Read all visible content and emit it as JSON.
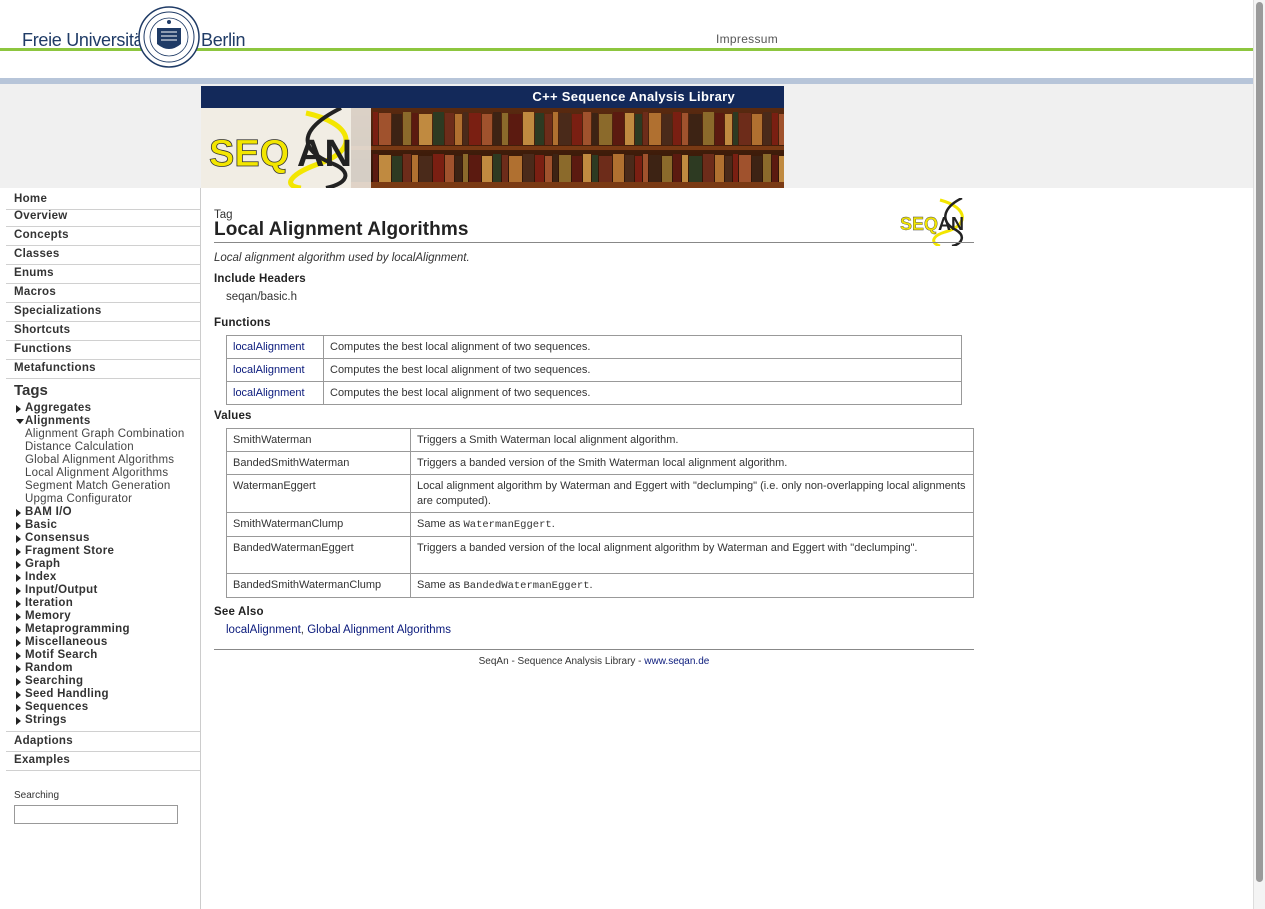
{
  "header": {
    "university_left": "Freie Universität",
    "university_right": "Berlin",
    "impressum": "Impressum"
  },
  "banner": {
    "subtitle": "C++ Sequence Analysis Library"
  },
  "nav": {
    "main": [
      "Home",
      "Overview",
      "Concepts",
      "Classes",
      "Enums",
      "Macros",
      "Specializations",
      "Shortcuts",
      "Functions",
      "Metafunctions"
    ],
    "tags_heading": "Tags",
    "tags_before": [
      "Aggregates"
    ],
    "expanded_tag": "Alignments",
    "expanded_children": [
      "Alignment Graph Combination",
      "Distance Calculation",
      "Global Alignment Algorithms",
      "Local Alignment Algorithms",
      "Segment Match Generation",
      "Upgma Configurator"
    ],
    "tags_after": [
      "BAM I/O",
      "Basic",
      "Consensus",
      "Fragment Store",
      "Graph",
      "Index",
      "Input/Output",
      "Iteration",
      "Memory",
      "Metaprogramming",
      "Miscellaneous",
      "Motif Search",
      "Random",
      "Searching",
      "Seed Handling",
      "Sequences",
      "Strings"
    ],
    "bottom": [
      "Adaptions",
      "Examples"
    ],
    "search_label": "Searching",
    "search_value": ""
  },
  "main": {
    "kind": "Tag",
    "title": "Local Alignment Algorithms",
    "summary": "Local alignment algorithm used by localAlignment.",
    "include_heading": "Include Headers",
    "include_file": "seqan/basic.h",
    "functions_heading": "Functions",
    "functions": [
      {
        "name": "localAlignment",
        "desc": "Computes the best local alignment of two sequences."
      },
      {
        "name": "localAlignment",
        "desc": "Computes the best local alignment of two sequences."
      },
      {
        "name": "localAlignment",
        "desc": "Computes the best local alignment of two sequences."
      }
    ],
    "values_heading": "Values",
    "values": [
      {
        "name": "SmithWaterman",
        "desc": "Triggers a Smith Waterman local alignment algorithm.",
        "code": ""
      },
      {
        "name": "BandedSmithWaterman",
        "desc": "Triggers a banded version of the Smith Waterman local alignment algorithm.",
        "code": ""
      },
      {
        "name": "WatermanEggert",
        "desc": "Local alignment algorithm by Waterman and Eggert with \"declumping\" (i.e. only non-overlapping local alignments are computed).",
        "code": ""
      },
      {
        "name": "SmithWatermanClump",
        "desc": "Same as ",
        "code": "WatermanEggert"
      },
      {
        "name": "BandedWatermanEggert",
        "desc": "Triggers a banded version of the local alignment algorithm by Waterman and Eggert with \"declumping\".",
        "code": ""
      },
      {
        "name": "BandedSmithWatermanClump",
        "desc": "Same as ",
        "code": "BandedWatermanEggert"
      }
    ],
    "see_also_heading": "See Also",
    "see_also": [
      "localAlignment",
      "Global Alignment Algorithms"
    ],
    "see_also_sep": ", "
  },
  "footer": {
    "text": "SeqAn - Sequence Analysis Library - ",
    "link": "www.seqan.de"
  },
  "logo": {
    "word_seq": "SEQ",
    "word_an": "AN"
  },
  "colors": {
    "fu_green": "#8dc63f",
    "fu_blue": "#1f3b66",
    "banner_navy": "#13295a",
    "link": "#0a1a7c",
    "seqan_yellow": "#f3e600"
  }
}
